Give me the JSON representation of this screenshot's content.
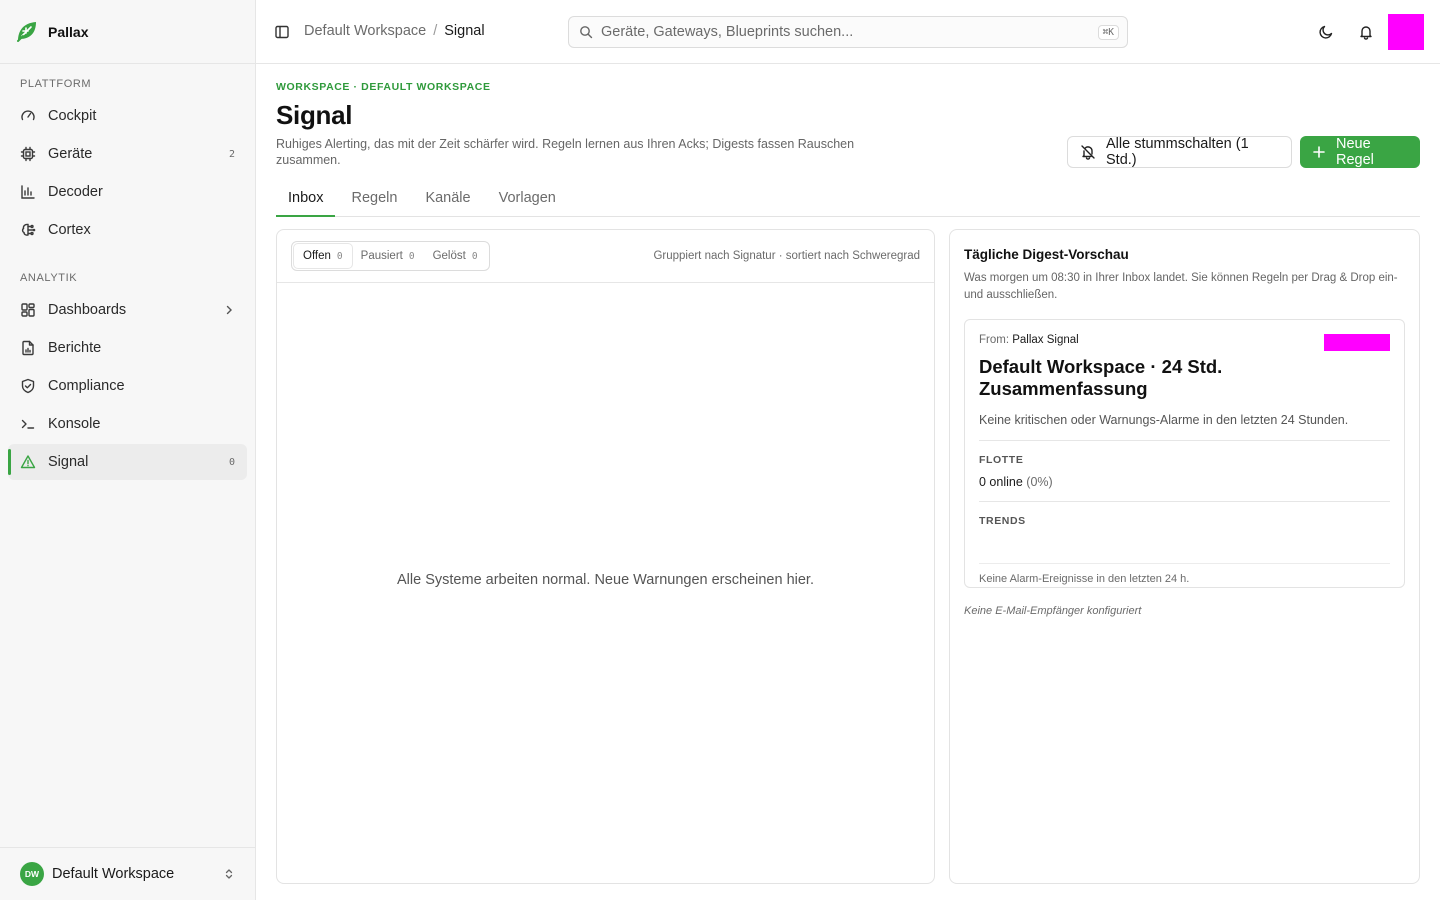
{
  "brand": {
    "name": "Pallax"
  },
  "sidebar": {
    "groups": [
      {
        "label": "PLATTFORM",
        "items": [
          {
            "label": "Cockpit",
            "icon": "gauge-icon"
          },
          {
            "label": "Geräte",
            "icon": "chip-icon",
            "count": "2"
          },
          {
            "label": "Decoder",
            "icon": "bar-chart-icon"
          },
          {
            "label": "Cortex",
            "icon": "brain-icon"
          }
        ]
      },
      {
        "label": "ANALYTIK",
        "items": [
          {
            "label": "Dashboards",
            "icon": "grid-icon",
            "chevron": true
          },
          {
            "label": "Berichte",
            "icon": "file-chart-icon"
          },
          {
            "label": "Compliance",
            "icon": "shield-check-icon"
          },
          {
            "label": "Konsole",
            "icon": "terminal-icon"
          },
          {
            "label": "Signal",
            "icon": "warning-icon",
            "count": "0",
            "active": true
          }
        ]
      }
    ],
    "workspace": {
      "initials": "DW",
      "name": "Default Workspace"
    }
  },
  "topbar": {
    "breadcrumb": [
      "Default Workspace",
      "Signal"
    ],
    "search_placeholder": "Geräte, Gateways, Blueprints suchen...",
    "search_shortcut": "⌘K"
  },
  "page": {
    "eyebrow": "WORKSPACE · DEFAULT WORKSPACE",
    "title": "Signal",
    "subtitle": "Ruhiges Alerting, das mit der Zeit schärfer wird. Regeln lernen aus Ihren Acks; Digests fassen Rauschen zusammen.",
    "mute_button": "Alle stummschalten (1 Std.)",
    "new_rule_button": "Neue Regel",
    "accent_color": "#3aa544"
  },
  "tabs": [
    {
      "label": "Inbox",
      "active": true
    },
    {
      "label": "Regeln"
    },
    {
      "label": "Kanäle"
    },
    {
      "label": "Vorlagen"
    }
  ],
  "inbox": {
    "filters": [
      {
        "label": "Offen",
        "count": "0",
        "active": true
      },
      {
        "label": "Pausiert",
        "count": "0"
      },
      {
        "label": "Gelöst",
        "count": "0"
      }
    ],
    "meta": "Gruppiert nach Signatur · sortiert nach Schweregrad",
    "empty_text": "Alle Systeme arbeiten normal. Neue Warnungen erscheinen hier."
  },
  "digest": {
    "title": "Tägliche Digest-Vorschau",
    "description": "Was morgen um 08:30 in Ihrer Inbox landet. Sie können Regeln per Drag & Drop ein- und ausschließen.",
    "mail": {
      "from_label": "From:",
      "from_name": "Pallax Signal",
      "title": "Default Workspace · 24 Std. Zusammenfassung",
      "lead": "Keine kritischen oder Warnungs-Alarme in den letzten 24 Stunden.",
      "fleet_label": "FLOTTE",
      "fleet_value": "0 online",
      "fleet_pct": "(0%)",
      "trends_label": "TRENDS",
      "footer": "Keine Alarm-Ereignisse in den letzten 24 h."
    },
    "no_recipients": "Keine E-Mail-Empfänger konfiguriert"
  }
}
